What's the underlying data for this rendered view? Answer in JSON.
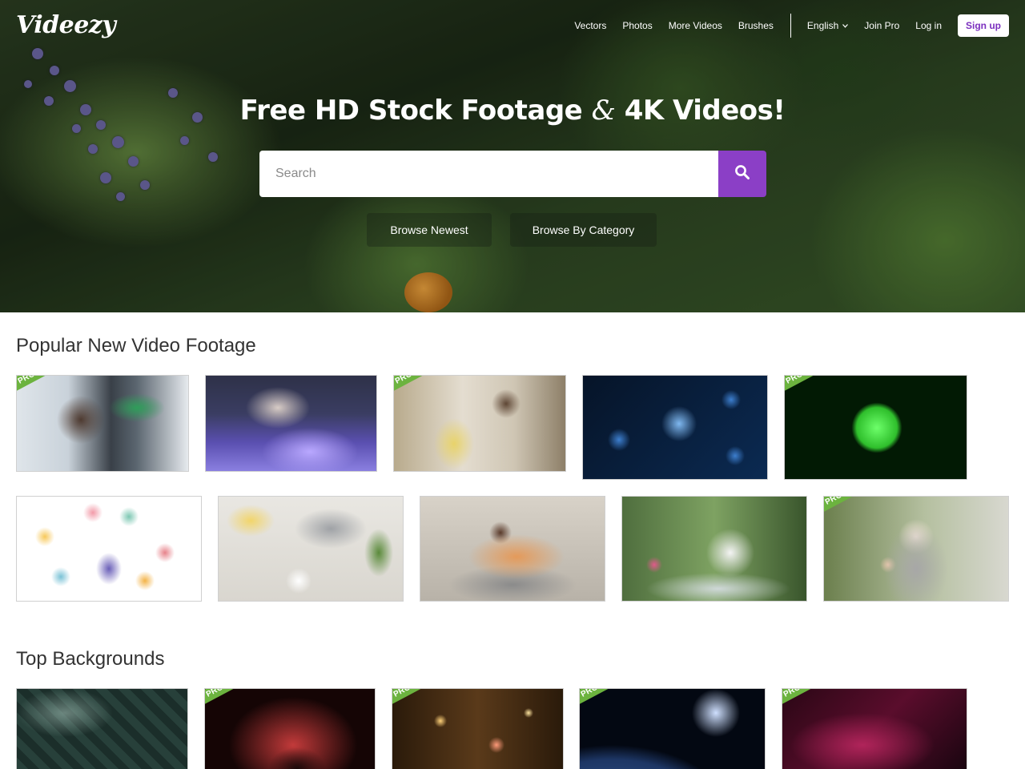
{
  "brand": {
    "logo_text": "Videezy"
  },
  "nav": {
    "links": [
      "Vectors",
      "Photos",
      "More Videos",
      "Brushes"
    ],
    "language": "English",
    "join_pro": "Join Pro",
    "login": "Log in",
    "signup": "Sign up"
  },
  "hero": {
    "title_part1": "Free HD Stock Footage",
    "title_amp": "&",
    "title_part2": "4K Videos!",
    "search_placeholder": "Search",
    "browse_newest": "Browse Newest",
    "browse_category": "Browse By Category"
  },
  "sections": {
    "popular_title": "Popular New Video Footage",
    "backgrounds_title": "Top Backgrounds"
  },
  "pro_label": "PRO",
  "colors": {
    "accent": "#8b3fc6",
    "pro_ribbon": "#6cb33f",
    "signup_text": "#7b2fbf"
  },
  "popular_row1": [
    {
      "name": "microscope-lab",
      "pro": true
    },
    {
      "name": "test-tubes-gloves",
      "pro": false
    },
    {
      "name": "lab-flask",
      "pro": true
    },
    {
      "name": "blue-virus",
      "pro": false
    },
    {
      "name": "green-cell",
      "pro": true
    }
  ],
  "popular_row2": [
    {
      "name": "ecommerce-illustration",
      "pro": false
    },
    {
      "name": "laptop-coffee-desk",
      "pro": false
    },
    {
      "name": "couple-sofa-phone",
      "pro": false
    },
    {
      "name": "woman-cafe-coffee",
      "pro": false
    },
    {
      "name": "masked-woman-thumbs-up",
      "pro": true
    }
  ],
  "backgrounds_row": [
    {
      "name": "green-maze",
      "pro": false
    },
    {
      "name": "red-particles-tunnel",
      "pro": true
    },
    {
      "name": "gold-bokeh-lights",
      "pro": true
    },
    {
      "name": "earth-from-space",
      "pro": true
    },
    {
      "name": "magenta-polygons",
      "pro": true
    }
  ]
}
